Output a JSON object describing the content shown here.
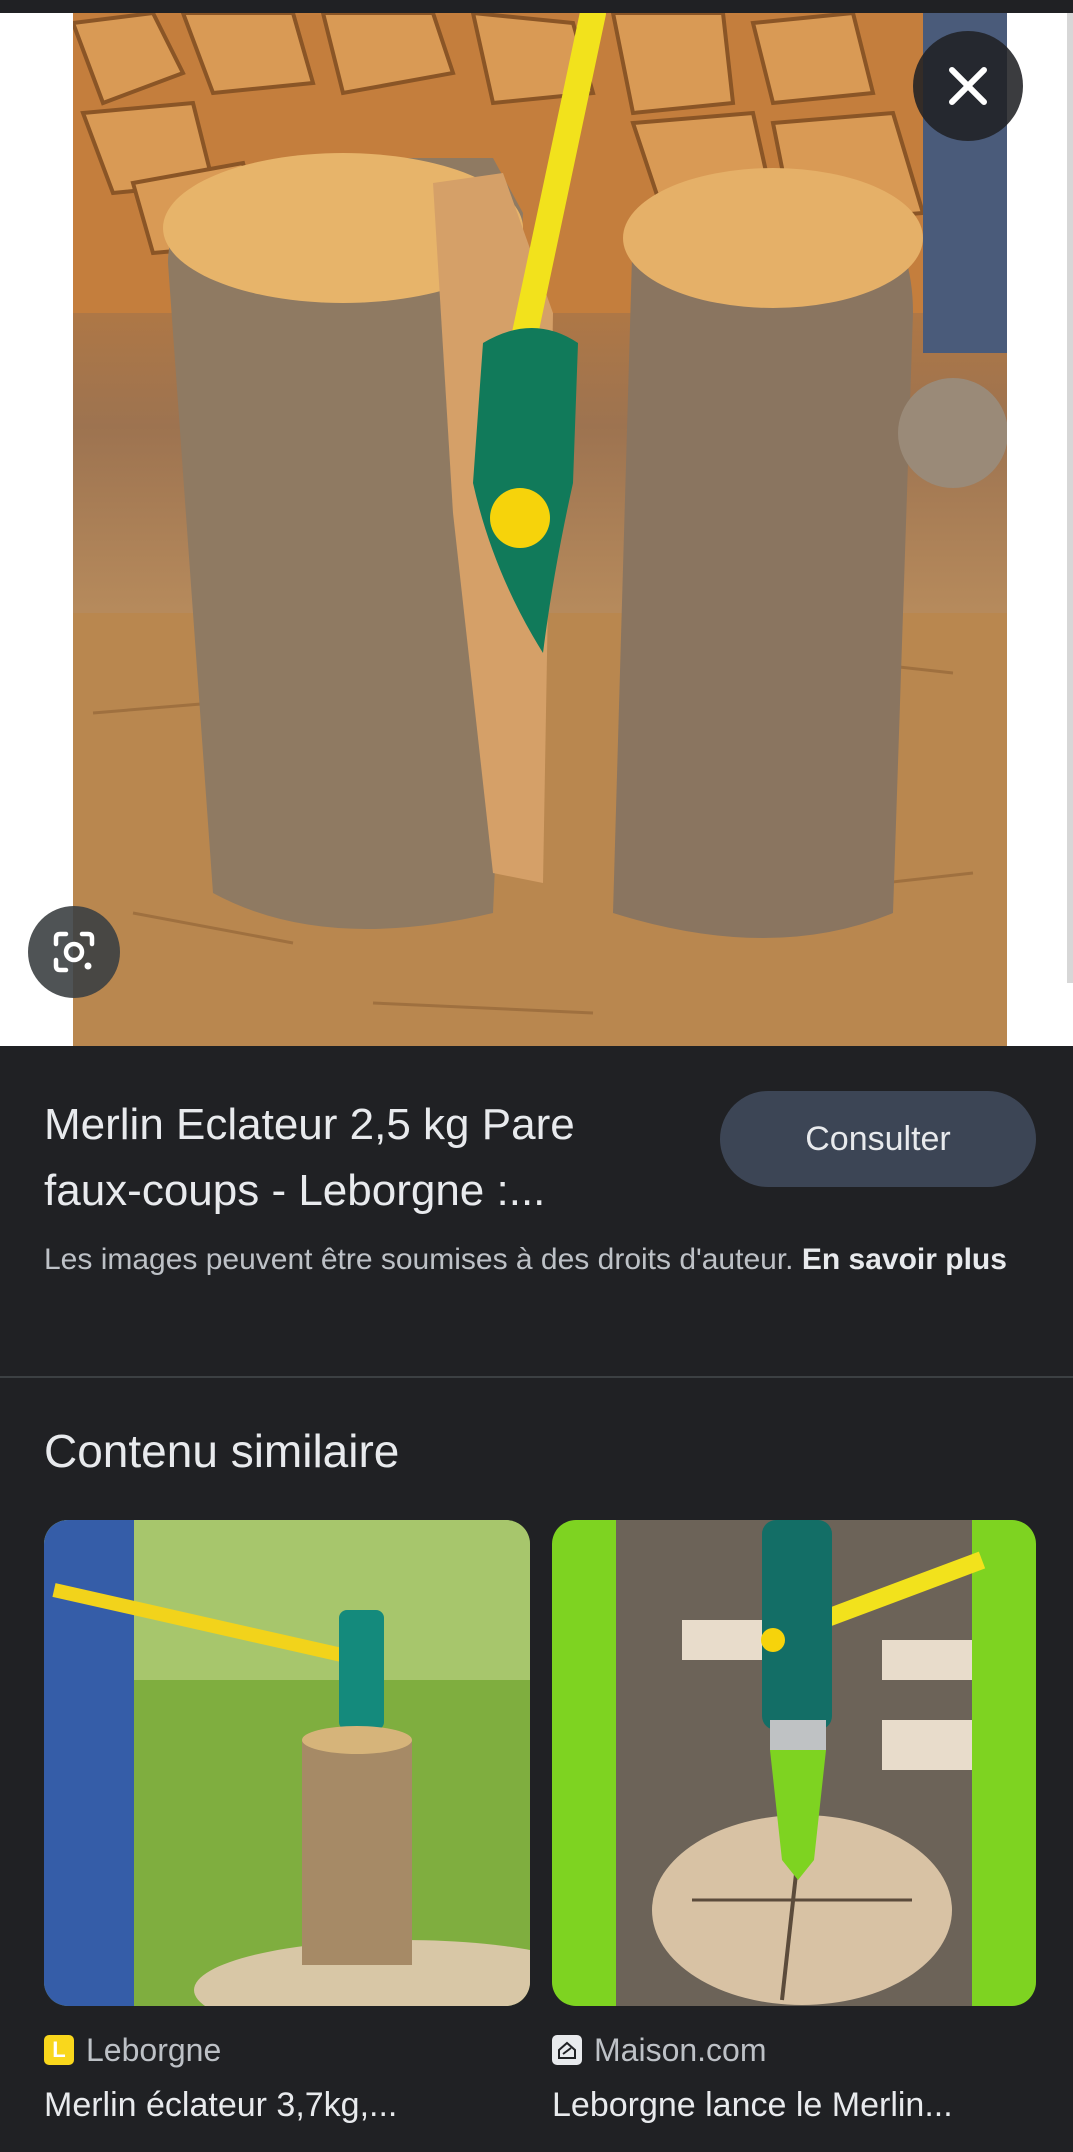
{
  "viewer": {
    "close_icon": "close-icon",
    "lens_icon": "google-lens-icon"
  },
  "result": {
    "title": "Merlin Eclateur 2,5 kg Pare faux-coups - Leborgne :...",
    "visit_label": "Consulter",
    "copyright_notice": "Les images peuvent être soumises à des droits d'auteur.",
    "learn_more": "En savoir plus"
  },
  "similar": {
    "heading": "Contenu similaire",
    "items": [
      {
        "source": "Leborgne",
        "favicon": "L",
        "title": "Merlin éclateur 3,7kg,..."
      },
      {
        "source": "Maison.com",
        "favicon": "house-icon",
        "title": "Leborgne lance le Merlin..."
      }
    ]
  },
  "colors": {
    "background": "#202124",
    "button_bg": "#3c4555",
    "text_primary": "#e8eaed",
    "text_secondary": "#bdc1c6",
    "leborgne_yellow": "#f9d71c",
    "green_accent": "#7ed321"
  }
}
